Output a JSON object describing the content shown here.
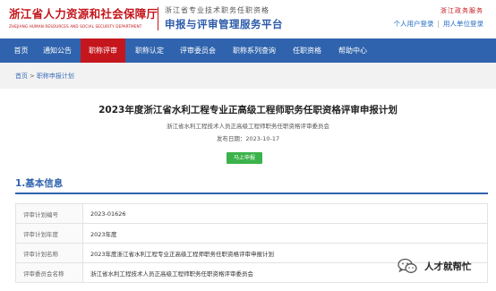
{
  "header": {
    "org_name": "浙江省人力资源和社会保障厅",
    "org_name_en": "ZHEJIANG HUMAN RESOURCES AND SOCIAL SECURITY DEPARTMENT",
    "system_subtitle": "浙江省专业技术职务任职资格",
    "system_title": "申报与评审管理服务平台",
    "province_text": "浙江政务服务",
    "personal_login": "个人用户登录",
    "separator": "|",
    "org_login": "用人单位登录"
  },
  "nav": {
    "items": [
      "首页",
      "通知公告",
      "职称评审",
      "职称认定",
      "评审委员会",
      "职称系列查询",
      "任职资格",
      "帮助中心"
    ],
    "active_index": 2
  },
  "breadcrumb": {
    "home": "首页",
    "arrow": ">",
    "current": "职称申报计划"
  },
  "plan": {
    "title": "2023年度浙江省水利工程专业正高级工程师职务任职资格评审申报计划",
    "committee": "浙江省水利工程技术人员正高级工程师职务任职资格评审委员会",
    "publish_date": "发布日期：2023-10-17",
    "status_button": "马上申报"
  },
  "section": {
    "title": "1.基本信息"
  },
  "info_rows": [
    {
      "label": "评审计划编号",
      "value": "2023-01626"
    },
    {
      "label": "评审计划年度",
      "value": "2023年度"
    },
    {
      "label": "评审计划名称",
      "value": "2023年度浙江省水利工程专业正高级工程师职务任职资格评审申报计划"
    },
    {
      "label": "评审委员会名称",
      "value": "浙江省水利工程技术人员正高级工程师职务任职资格评审委员会"
    }
  ],
  "watermark": {
    "icon": "wechat-icon",
    "text": "人才就帮忙"
  },
  "colors": {
    "brand_red": "#c4161c",
    "nav_blue": "#2f63ad",
    "button_green": "#3bb34a"
  }
}
